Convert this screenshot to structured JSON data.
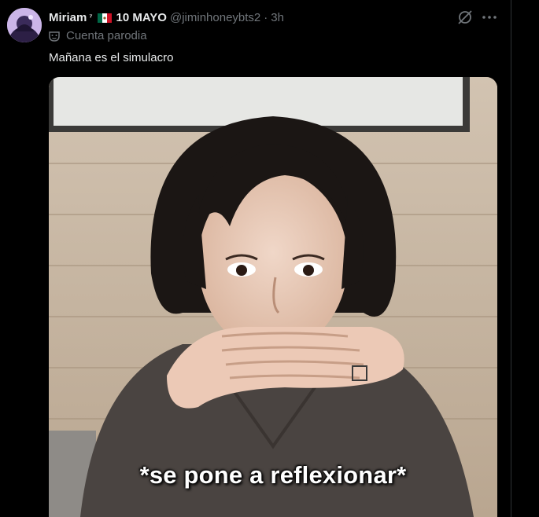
{
  "tweet": {
    "author_name": "Miriam",
    "author_sup": "⁷",
    "date_label": "10 MAYO",
    "handle": "@jiminhoneybts2",
    "separator": "·",
    "time": "3h",
    "parody_label": "Cuenta parodia",
    "text": "Mañana es el simulacro",
    "media_caption": "*se pone a reflexionar*"
  },
  "icons": {
    "avatar": "avatar-image",
    "flag": "mexico-flag-icon",
    "parody": "parody-mask-icon",
    "grok": "grok-icon",
    "more": "more-icon"
  },
  "colors": {
    "background": "#000000",
    "text": "#e7e9ea",
    "muted": "#71767b",
    "divider": "#2f3336"
  }
}
